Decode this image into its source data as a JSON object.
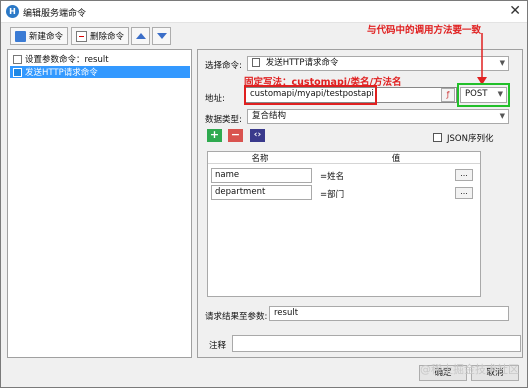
{
  "window": {
    "title": "编辑服务端命令",
    "app_icon": "H"
  },
  "toolbar": {
    "new_label": "新建命令",
    "delete_label": "删除命令"
  },
  "tree": {
    "items": [
      {
        "label": "设置参数命令：result"
      },
      {
        "label": "发送HTTP请求命令"
      }
    ]
  },
  "form": {
    "command_label": "选择命令:",
    "command_value": "发送HTTP请求命令",
    "address_label": "地址:",
    "address_value": "customapi/myapi/testpostapi",
    "method_value": "POST",
    "datatype_label": "数据类型:",
    "datatype_value": "复合结构",
    "json_label": "JSON序列化",
    "grid_headers": [
      "名称",
      "值"
    ],
    "rows": [
      {
        "name": "name",
        "value": "=姓名"
      },
      {
        "name": "department",
        "value": "=部门"
      }
    ],
    "result_label": "请求结果至参数:",
    "result_value": "result",
    "note_label": "注释",
    "note_value": ""
  },
  "annotations": {
    "method_note": "与代码中的调用方法要一致",
    "fixed_prefix": "固定写法：",
    "prefix_value": "customapi/",
    "class_method": "类名/方法名"
  },
  "buttons": {
    "ok": "确定",
    "cancel": "取消"
  },
  "watermark": "@稀土掘金技术社区",
  "colors": {
    "accent": "#3399ff",
    "annotation_red": "#e02020",
    "annotation_green": "#22c02a",
    "add_green": "#2faa4f",
    "remove_red": "#d9534f",
    "code_purple": "#3a3a8c"
  }
}
